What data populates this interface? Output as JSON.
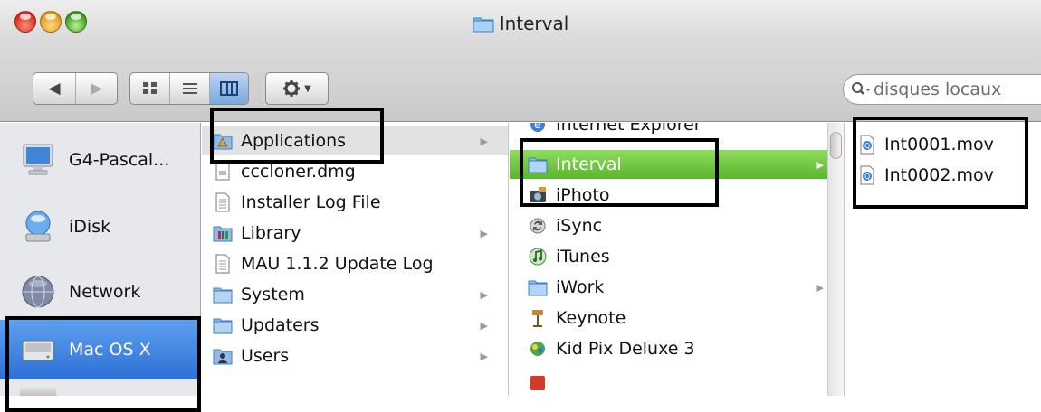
{
  "window": {
    "title": "Interval"
  },
  "toolbar": {
    "back_icon": "back-arrow-icon",
    "forward_icon": "forward-arrow-icon",
    "views": [
      "icon-view-icon",
      "list-view-icon",
      "column-view-icon"
    ],
    "active_view": "column",
    "action_icon": "gear-icon",
    "search_placeholder": "disques locaux"
  },
  "sidebar": {
    "items": [
      {
        "label": "G4-Pascal...",
        "icon": "monitor-icon"
      },
      {
        "label": "iDisk",
        "icon": "idisk-icon"
      },
      {
        "label": "Network",
        "icon": "globe-icon"
      },
      {
        "label": "Mac OS X",
        "icon": "hard-drive-icon",
        "selected": true
      }
    ]
  },
  "columns": {
    "col1": {
      "items": [
        {
          "label": "Applications",
          "icon": "applications-folder-icon",
          "selected": true,
          "has_children": true
        },
        {
          "label": "cccloner.dmg",
          "icon": "disk-image-icon"
        },
        {
          "label": "Installer Log File",
          "icon": "document-icon"
        },
        {
          "label": "Library",
          "icon": "library-folder-icon",
          "has_children": true
        },
        {
          "label": "MAU 1.1.2 Update Log",
          "icon": "document-icon"
        },
        {
          "label": "System",
          "icon": "folder-icon",
          "has_children": true
        },
        {
          "label": "Updaters",
          "icon": "folder-icon",
          "has_children": true
        },
        {
          "label": "Users",
          "icon": "users-folder-icon",
          "has_children": true
        }
      ]
    },
    "col2": {
      "items": [
        {
          "label": "Internet Explorer",
          "icon": "internet-explorer-icon"
        },
        {
          "label": "Interval",
          "icon": "folder-icon",
          "active": true,
          "has_children": true
        },
        {
          "label": "iPhoto",
          "icon": "iphoto-icon"
        },
        {
          "label": "iSync",
          "icon": "isync-icon"
        },
        {
          "label": "iTunes",
          "icon": "itunes-icon"
        },
        {
          "label": "iWork",
          "icon": "folder-icon",
          "has_children": true
        },
        {
          "label": "Keynote",
          "icon": "keynote-icon"
        },
        {
          "label": "Kid Pix Deluxe 3",
          "icon": "kidpix-icon"
        }
      ]
    },
    "col3": {
      "items": [
        {
          "label": "Int0001.mov",
          "icon": "movie-file-icon"
        },
        {
          "label": "Int0002.mov",
          "icon": "movie-file-icon"
        }
      ]
    }
  },
  "colors": {
    "selection_blue": "#2e6fd6",
    "selection_green": "#5bb52d",
    "annotation_box": "#000000"
  },
  "chevron": "▶"
}
